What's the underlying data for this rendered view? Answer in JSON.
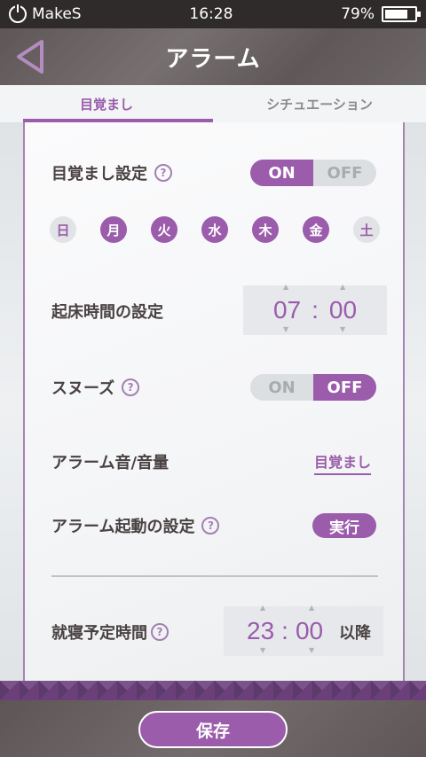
{
  "status_bar": {
    "app_name": "MakeS",
    "time": "16:28",
    "battery": "79%",
    "battery_level": 0.79
  },
  "header": {
    "title": "アラーム"
  },
  "tabs": [
    {
      "label": "目覚まし",
      "active": true
    },
    {
      "label": "シチュエーション",
      "active": false
    }
  ],
  "wake": {
    "label": "目覚まし設定",
    "help": "?",
    "on_label": "ON",
    "off_label": "OFF",
    "state": "ON"
  },
  "days": [
    {
      "label": "日",
      "selected": false
    },
    {
      "label": "月",
      "selected": true
    },
    {
      "label": "火",
      "selected": true
    },
    {
      "label": "水",
      "selected": true
    },
    {
      "label": "木",
      "selected": true
    },
    {
      "label": "金",
      "selected": true
    },
    {
      "label": "土",
      "selected": false
    }
  ],
  "wake_time": {
    "label": "起床時間の設定",
    "hour": "07",
    "sep": ":",
    "minute": "00"
  },
  "snooze": {
    "label": "スヌーズ",
    "help": "?",
    "on_label": "ON",
    "off_label": "OFF",
    "state": "OFF"
  },
  "alarm_sound": {
    "label": "アラーム音/音量",
    "value": "目覚まし"
  },
  "alarm_start": {
    "label": "アラーム起動の設定",
    "help": "?",
    "button": "実行"
  },
  "bed_time": {
    "label": "就寝予定時間",
    "help": "?",
    "hour": "23",
    "sep": ":",
    "minute": "00",
    "suffix": "以降"
  },
  "footer": {
    "save_label": "保存"
  },
  "colors": {
    "accent": "#9a5cab",
    "header": "#6a6262",
    "status_bar": "#2f2b2b"
  }
}
